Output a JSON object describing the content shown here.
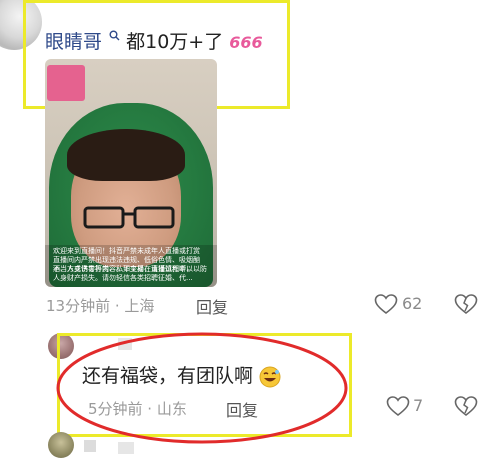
{
  "comment1": {
    "username": "眼睛哥",
    "text": "都10万+了",
    "emoji": "666",
    "meta": "13分钟前 · 上海",
    "reply": "回复",
    "likes": "62",
    "image_caption_lines": [
      "欢迎来到直播间！抖音严禁未成年人直播或打赏",
      "直播间内严禁出现违法违规、低俗色情、吸烟酗酒、人身伤害等内容。如主播在直播过程中以",
      "不当方式诱导打赏、私下交易，请谨慎判断，以防",
      "人身财产损失。请勿轻信各类招聘征婚、代..."
    ]
  },
  "comment2": {
    "text": "还有福袋，有团队啊",
    "meta": "5分钟前 · 山东",
    "reply": "回复",
    "likes": "7"
  },
  "colors": {
    "highlight_yellow": "#ecea2a",
    "annotation_red": "#e12b2b",
    "username_blue": "#2f4a8a",
    "emoji_pink": "#e85a9b"
  }
}
